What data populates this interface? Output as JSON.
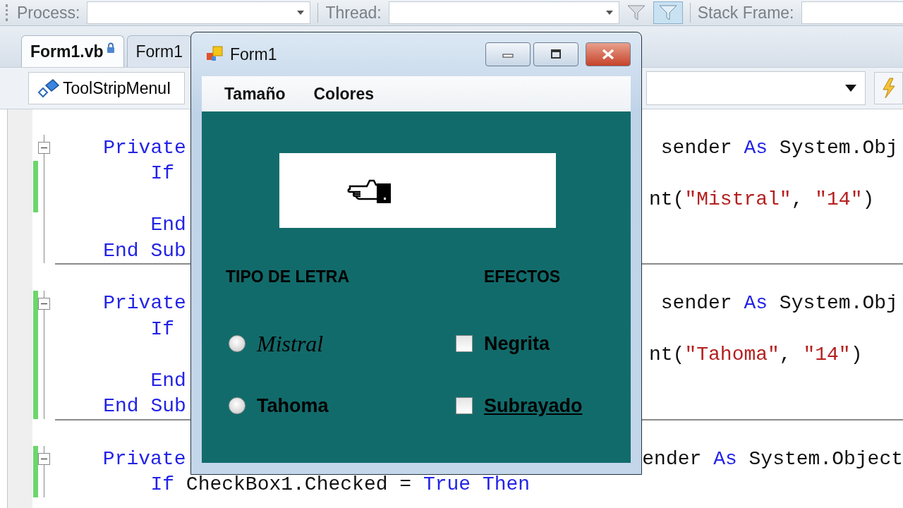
{
  "debug_toolbar": {
    "process_label": "Process:",
    "thread_label": "Thread:",
    "stack_frame_label": "Stack Frame:"
  },
  "tabs": [
    {
      "label": "Form1.vb",
      "selected": true,
      "locked": true
    },
    {
      "label": "Form1",
      "selected": false,
      "locked": false
    }
  ],
  "nav_bar": {
    "member_dropdown": "ToolStripMenuI"
  },
  "editor": {
    "methods": [
      {
        "lines": [
          {
            "changed": false,
            "left": [
              {
                "kind": "kw",
                "text": "    Private"
              }
            ],
            "right": [
              {
                "kind": "txt",
                "text": " sender "
              },
              {
                "kind": "kw",
                "text": "As"
              },
              {
                "kind": "txt",
                "text": " System.Obj"
              }
            ]
          },
          {
            "changed": true,
            "left": [
              {
                "kind": "kw",
                "text": "        If"
              }
            ]
          },
          {
            "changed": true,
            "right": [
              {
                "kind": "txt",
                "text": "nt("
              },
              {
                "kind": "str",
                "text": "\"Mistral\""
              },
              {
                "kind": "txt",
                "text": ", "
              },
              {
                "kind": "str",
                "text": "\"14\""
              },
              {
                "kind": "txt",
                "text": ")"
              }
            ]
          },
          {
            "changed": false,
            "left": [
              {
                "kind": "kw",
                "text": "        End"
              }
            ]
          },
          {
            "changed": false,
            "left": [
              {
                "kind": "kw",
                "text": "    End Sub"
              }
            ]
          }
        ]
      },
      {
        "lines": [
          {
            "changed": true,
            "left": [
              {
                "kind": "kw",
                "text": "    Private"
              }
            ],
            "right": [
              {
                "kind": "txt",
                "text": " sender "
              },
              {
                "kind": "kw",
                "text": "As"
              },
              {
                "kind": "txt",
                "text": " System.Obj"
              }
            ]
          },
          {
            "changed": true,
            "left": [
              {
                "kind": "kw",
                "text": "        If"
              }
            ]
          },
          {
            "changed": true,
            "right": [
              {
                "kind": "txt",
                "text": "nt("
              },
              {
                "kind": "str",
                "text": "\"Tahoma\""
              },
              {
                "kind": "txt",
                "text": ", "
              },
              {
                "kind": "str",
                "text": "\"14\""
              },
              {
                "kind": "txt",
                "text": ")"
              }
            ]
          },
          {
            "changed": true,
            "left": [
              {
                "kind": "kw",
                "text": "        End"
              }
            ]
          },
          {
            "changed": true,
            "left": [
              {
                "kind": "kw",
                "text": "    End Sub"
              }
            ]
          }
        ]
      },
      {
        "lines": [
          {
            "changed": true,
            "left": [
              {
                "kind": "kw",
                "text": "    Private"
              }
            ],
            "right": [
              {
                "kind": "txt",
                "text": "ender "
              },
              {
                "kind": "kw",
                "text": "As"
              },
              {
                "kind": "txt",
                "text": " System.Object"
              }
            ]
          },
          {
            "changed": true,
            "left": [
              {
                "kind": "kw",
                "text": "        If"
              },
              {
                "kind": "txt",
                "text": " CheckBox1.Checked = "
              },
              {
                "kind": "kw",
                "text": "True"
              },
              {
                "kind": "kw",
                "text": " Then"
              }
            ]
          }
        ]
      }
    ]
  },
  "form_window": {
    "title": "Form1",
    "menu": [
      "Tamaño",
      "Colores"
    ],
    "font_group_label": "TIPO DE LETRA",
    "effects_group_label": "EFECTOS",
    "font_options": [
      {
        "label": "Mistral",
        "kind": "script",
        "selected": false
      },
      {
        "label": "Tahoma",
        "kind": "bold",
        "selected": false
      }
    ],
    "effects": [
      {
        "label": "Negrita",
        "kind": "bold",
        "checked": false
      },
      {
        "label": "Subrayado",
        "kind": "underline",
        "checked": false
      }
    ]
  }
}
